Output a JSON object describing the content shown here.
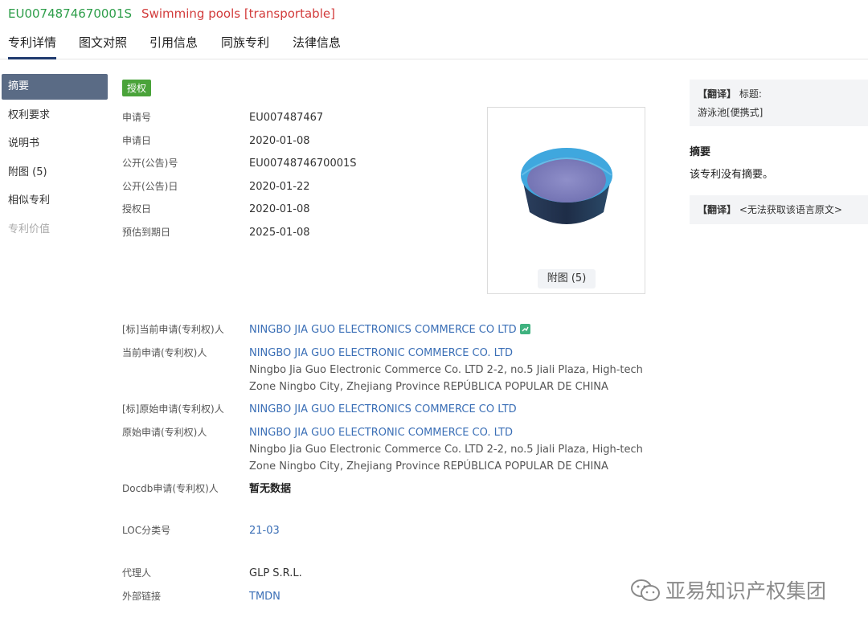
{
  "header": {
    "patent_number": "EU0074874670001S",
    "title": "Swimming pools [transportable]"
  },
  "tabs": [
    "专利详情",
    "图文对照",
    "引用信息",
    "同族专利",
    "法律信息"
  ],
  "sidebar": {
    "items": [
      {
        "label": "摘要"
      },
      {
        "label": "权利要求"
      },
      {
        "label": "说明书"
      },
      {
        "label": "附图 (5)"
      },
      {
        "label": "相似专利"
      },
      {
        "label": "专利价值"
      }
    ]
  },
  "status_badge": "授权",
  "basic_fields": [
    {
      "label": "申请号",
      "value": "EU007487467"
    },
    {
      "label": "申请日",
      "value": "2020-01-08"
    },
    {
      "label": "公开(公告)号",
      "value": "EU0074874670001S"
    },
    {
      "label": "公开(公告)日",
      "value": "2020-01-22"
    },
    {
      "label": "授权日",
      "value": "2020-01-08"
    },
    {
      "label": "预估到期日",
      "value": "2025-01-08"
    }
  ],
  "figure": {
    "button_label": "附图 (5)"
  },
  "parties": [
    {
      "label": "[标]当前申请(专利权)人",
      "name": "NINGBO JIA GUO ELECTRONICS COMMERCE CO LTD"
    },
    {
      "label": "当前申请(专利权)人",
      "name": "NINGBO JIA GUO ELECTRONIC COMMERCE CO. LTD",
      "address_line1": "Ningbo Jia Guo Electronic Commerce Co. LTD 2-2, no.5 Jiali Plaza, High-tech",
      "address_line2": "Zone Ningbo City, Zhejiang Province REPÚBLICA POPULAR DE CHINA"
    },
    {
      "label": "[标]原始申请(专利权)人",
      "name": "NINGBO JIA GUO ELECTRONICS COMMERCE CO LTD"
    },
    {
      "label": "原始申请(专利权)人",
      "name": "NINGBO JIA GUO ELECTRONIC COMMERCE CO. LTD",
      "address_line1": "Ningbo Jia Guo Electronic Commerce Co. LTD 2-2, no.5 Jiali Plaza, High-tech",
      "address_line2": "Zone Ningbo City, Zhejiang Province REPÚBLICA POPULAR DE CHINA"
    },
    {
      "label": "Docdb申请(专利权)人",
      "name": "暂无数据"
    }
  ],
  "loc": {
    "label": "LOC分类号",
    "value": "21-03"
  },
  "agent": {
    "label": "代理人",
    "value": "GLP S.R.L."
  },
  "external_link": {
    "label": "外部链接",
    "value": "TMDN"
  },
  "right_panel": {
    "translate_label": "【翻译】",
    "title_label": "标题:",
    "title_translation": "游泳池[便携式]",
    "abstract_heading": "摘要",
    "abstract_text": "该专利没有摘要。",
    "translate_label2": "【翻译】",
    "unavailable_text": "<无法获取该语言原文>"
  },
  "watermark": "亚易知识产权集团",
  "colors": {
    "accent": "#1f3a6e",
    "badge": "#4aa33a",
    "link": "#3b6fb6",
    "title_red": "#d23b3b",
    "number_green": "#2e9e4a"
  }
}
